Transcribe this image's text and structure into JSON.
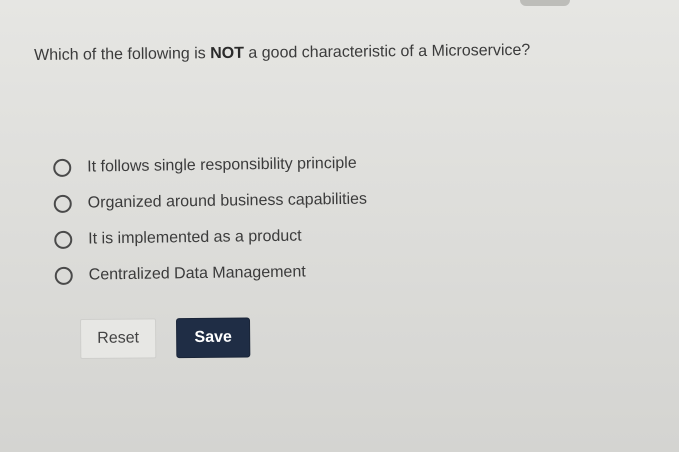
{
  "question": {
    "prefix": "Which of the following is ",
    "emphasis": "NOT",
    "suffix": " a good characteristic of a Microservice?"
  },
  "options": [
    {
      "label": "It follows single responsibility principle",
      "selected": false
    },
    {
      "label": "Organized around business capabilities",
      "selected": false
    },
    {
      "label": "It is implemented as a product",
      "selected": false
    },
    {
      "label": "Centralized Data Management",
      "selected": false
    }
  ],
  "buttons": {
    "reset_label": "Reset",
    "save_label": "Save"
  },
  "colors": {
    "save_button_bg": "#1f2d45",
    "page_bg": "#e3e3e0"
  }
}
